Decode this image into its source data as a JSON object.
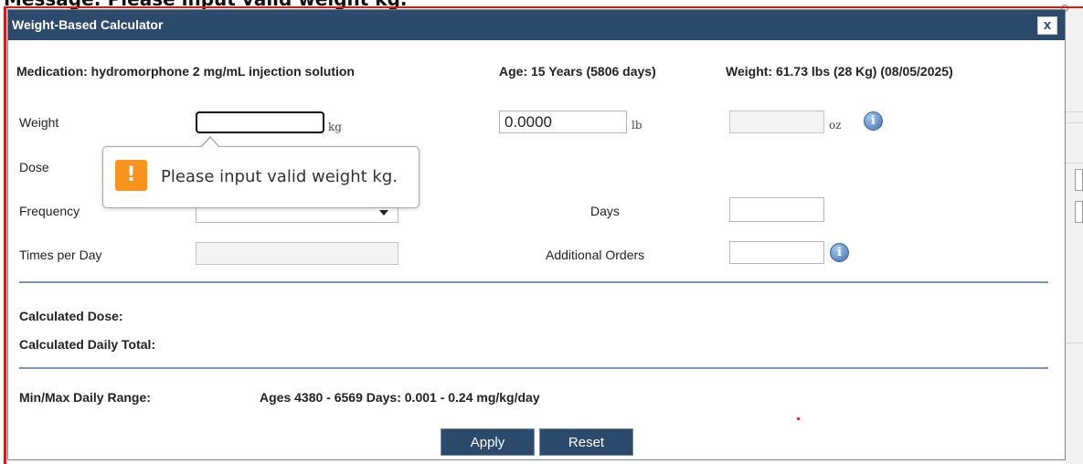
{
  "page_caption": "Message: Please input valid weight kg.",
  "dialog": {
    "title": "Weight-Based Calculator",
    "close_label": "x",
    "close_icon": "close-icon"
  },
  "patient_info": {
    "medication": "Medication: hydromorphone 2 mg/mL injection solution",
    "age": "Age: 15 Years (5806 days)",
    "weight": "Weight: 61.73 lbs (28 Kg) (08/05/2025)"
  },
  "form": {
    "weight_label": "Weight",
    "weight_kg_value": "",
    "kg_unit": "kg",
    "weight_lb_value": "0.0000",
    "lb_unit": "lb",
    "weight_oz_value": "",
    "oz_unit": "oz",
    "dose_label": "Dose",
    "frequency_label": "Frequency",
    "frequency_value": "",
    "days_label": "Days",
    "days_value": "",
    "times_per_day_label": "Times per Day",
    "times_per_day_value": "",
    "additional_orders_label": "Additional Orders",
    "additional_orders_value": "",
    "info_glyph": "i"
  },
  "results": {
    "calculated_dose_label": "Calculated Dose:",
    "calculated_daily_total_label": "Calculated Daily Total:",
    "min_max_label": "Min/Max Daily Range:",
    "min_max_value": "Ages 4380 - 6569 Days: 0.001 - 0.24 mg/kg/day"
  },
  "buttons": {
    "apply": "Apply",
    "reset": "Reset"
  },
  "tooltip": {
    "icon_glyph": "!",
    "message": "Please input valid weight kg."
  },
  "colors": {
    "title_bar": "#2c4a6b",
    "warning": "#f7941d",
    "frame": "#e01515"
  }
}
